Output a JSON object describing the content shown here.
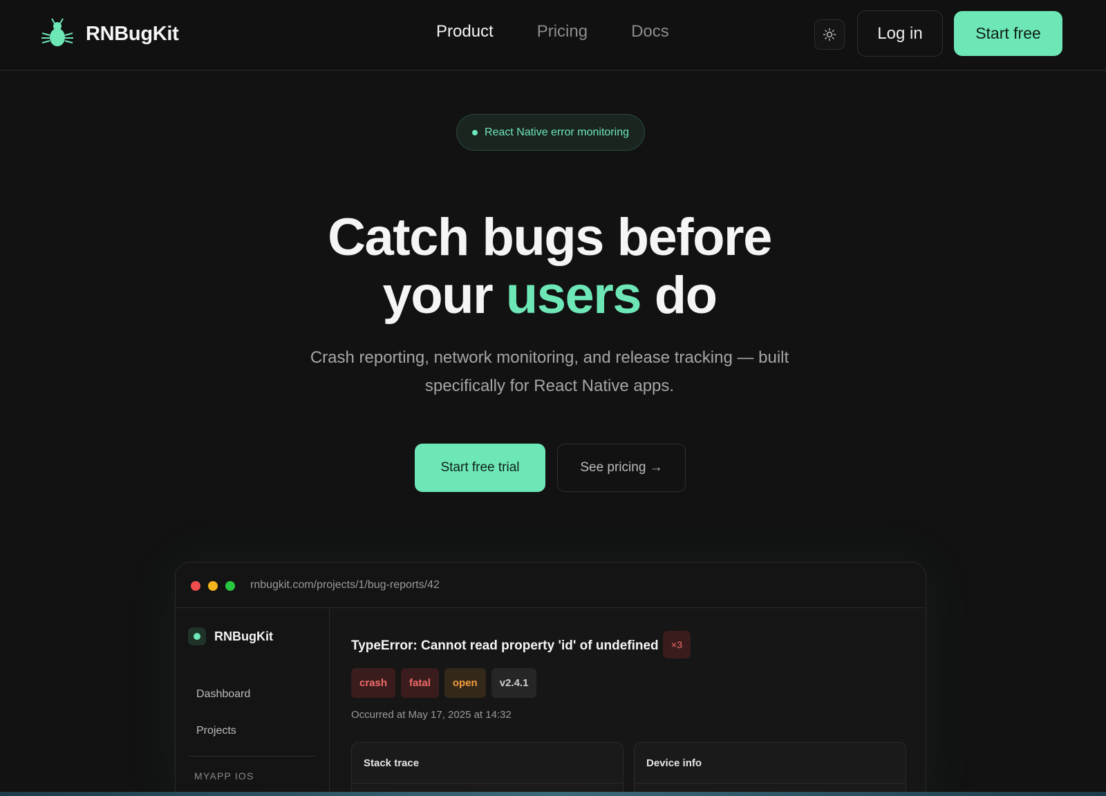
{
  "nav": {
    "brand": "RNBugKit",
    "links": [
      "Product",
      "Pricing",
      "Docs"
    ],
    "login_label": "Log in",
    "start_label": "Start free"
  },
  "hero": {
    "pill": "React Native error monitoring",
    "title_line1": "Catch bugs before",
    "title_line2_pre": "your ",
    "title_line2_accent": "users",
    "title_line2_post": " do",
    "subtitle": "Crash reporting, network monitoring, and release tracking — built specifically for React Native apps.",
    "cta_primary": "Start free trial",
    "cta_secondary": "See pricing →"
  },
  "mock": {
    "url": "rnbugkit.com/projects/1/bug-reports/42",
    "sidebar": {
      "brand": "RNBugKit",
      "items": [
        "Dashboard",
        "Projects"
      ],
      "section": "MYAPP IOS"
    },
    "report": {
      "title": "TypeError: Cannot read property 'id' of undefined",
      "count": "×3",
      "tags": [
        "crash",
        "fatal",
        "open",
        "v2.4.1"
      ],
      "occurred": "Occurred at May 17, 2025 at 14:32",
      "panels": [
        "Stack trace",
        "Device info"
      ]
    }
  },
  "colors": {
    "accent": "#6ee7b7",
    "background": "#121212",
    "danger": "#f36b6b",
    "warning": "#f59e3b"
  },
  "icons": {
    "brand": "bug-icon",
    "theme_toggle": "sun-icon"
  }
}
